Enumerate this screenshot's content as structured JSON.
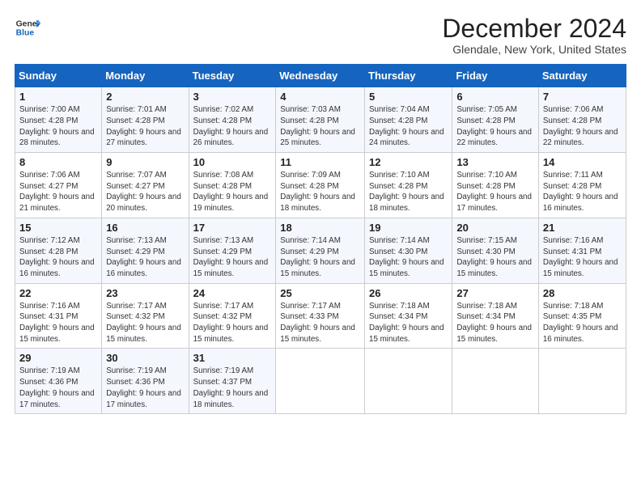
{
  "header": {
    "logo_line1": "General",
    "logo_line2": "Blue",
    "title": "December 2024",
    "subtitle": "Glendale, New York, United States"
  },
  "columns": [
    "Sunday",
    "Monday",
    "Tuesday",
    "Wednesday",
    "Thursday",
    "Friday",
    "Saturday"
  ],
  "weeks": [
    [
      {
        "day": "1",
        "rise": "Sunrise: 7:00 AM",
        "set": "Sunset: 4:28 PM",
        "day_text": "Daylight: 9 hours and 28 minutes."
      },
      {
        "day": "2",
        "rise": "Sunrise: 7:01 AM",
        "set": "Sunset: 4:28 PM",
        "day_text": "Daylight: 9 hours and 27 minutes."
      },
      {
        "day": "3",
        "rise": "Sunrise: 7:02 AM",
        "set": "Sunset: 4:28 PM",
        "day_text": "Daylight: 9 hours and 26 minutes."
      },
      {
        "day": "4",
        "rise": "Sunrise: 7:03 AM",
        "set": "Sunset: 4:28 PM",
        "day_text": "Daylight: 9 hours and 25 minutes."
      },
      {
        "day": "5",
        "rise": "Sunrise: 7:04 AM",
        "set": "Sunset: 4:28 PM",
        "day_text": "Daylight: 9 hours and 24 minutes."
      },
      {
        "day": "6",
        "rise": "Sunrise: 7:05 AM",
        "set": "Sunset: 4:28 PM",
        "day_text": "Daylight: 9 hours and 22 minutes."
      },
      {
        "day": "7",
        "rise": "Sunrise: 7:06 AM",
        "set": "Sunset: 4:28 PM",
        "day_text": "Daylight: 9 hours and 22 minutes."
      }
    ],
    [
      {
        "day": "8",
        "rise": "Sunrise: 7:06 AM",
        "set": "Sunset: 4:27 PM",
        "day_text": "Daylight: 9 hours and 21 minutes."
      },
      {
        "day": "9",
        "rise": "Sunrise: 7:07 AM",
        "set": "Sunset: 4:27 PM",
        "day_text": "Daylight: 9 hours and 20 minutes."
      },
      {
        "day": "10",
        "rise": "Sunrise: 7:08 AM",
        "set": "Sunset: 4:28 PM",
        "day_text": "Daylight: 9 hours and 19 minutes."
      },
      {
        "day": "11",
        "rise": "Sunrise: 7:09 AM",
        "set": "Sunset: 4:28 PM",
        "day_text": "Daylight: 9 hours and 18 minutes."
      },
      {
        "day": "12",
        "rise": "Sunrise: 7:10 AM",
        "set": "Sunset: 4:28 PM",
        "day_text": "Daylight: 9 hours and 18 minutes."
      },
      {
        "day": "13",
        "rise": "Sunrise: 7:10 AM",
        "set": "Sunset: 4:28 PM",
        "day_text": "Daylight: 9 hours and 17 minutes."
      },
      {
        "day": "14",
        "rise": "Sunrise: 7:11 AM",
        "set": "Sunset: 4:28 PM",
        "day_text": "Daylight: 9 hours and 16 minutes."
      }
    ],
    [
      {
        "day": "15",
        "rise": "Sunrise: 7:12 AM",
        "set": "Sunset: 4:28 PM",
        "day_text": "Daylight: 9 hours and 16 minutes."
      },
      {
        "day": "16",
        "rise": "Sunrise: 7:13 AM",
        "set": "Sunset: 4:29 PM",
        "day_text": "Daylight: 9 hours and 16 minutes."
      },
      {
        "day": "17",
        "rise": "Sunrise: 7:13 AM",
        "set": "Sunset: 4:29 PM",
        "day_text": "Daylight: 9 hours and 15 minutes."
      },
      {
        "day": "18",
        "rise": "Sunrise: 7:14 AM",
        "set": "Sunset: 4:29 PM",
        "day_text": "Daylight: 9 hours and 15 minutes."
      },
      {
        "day": "19",
        "rise": "Sunrise: 7:14 AM",
        "set": "Sunset: 4:30 PM",
        "day_text": "Daylight: 9 hours and 15 minutes."
      },
      {
        "day": "20",
        "rise": "Sunrise: 7:15 AM",
        "set": "Sunset: 4:30 PM",
        "day_text": "Daylight: 9 hours and 15 minutes."
      },
      {
        "day": "21",
        "rise": "Sunrise: 7:16 AM",
        "set": "Sunset: 4:31 PM",
        "day_text": "Daylight: 9 hours and 15 minutes."
      }
    ],
    [
      {
        "day": "22",
        "rise": "Sunrise: 7:16 AM",
        "set": "Sunset: 4:31 PM",
        "day_text": "Daylight: 9 hours and 15 minutes."
      },
      {
        "day": "23",
        "rise": "Sunrise: 7:17 AM",
        "set": "Sunset: 4:32 PM",
        "day_text": "Daylight: 9 hours and 15 minutes."
      },
      {
        "day": "24",
        "rise": "Sunrise: 7:17 AM",
        "set": "Sunset: 4:32 PM",
        "day_text": "Daylight: 9 hours and 15 minutes."
      },
      {
        "day": "25",
        "rise": "Sunrise: 7:17 AM",
        "set": "Sunset: 4:33 PM",
        "day_text": "Daylight: 9 hours and 15 minutes."
      },
      {
        "day": "26",
        "rise": "Sunrise: 7:18 AM",
        "set": "Sunset: 4:34 PM",
        "day_text": "Daylight: 9 hours and 15 minutes."
      },
      {
        "day": "27",
        "rise": "Sunrise: 7:18 AM",
        "set": "Sunset: 4:34 PM",
        "day_text": "Daylight: 9 hours and 15 minutes."
      },
      {
        "day": "28",
        "rise": "Sunrise: 7:18 AM",
        "set": "Sunset: 4:35 PM",
        "day_text": "Daylight: 9 hours and 16 minutes."
      }
    ],
    [
      {
        "day": "29",
        "rise": "Sunrise: 7:19 AM",
        "set": "Sunset: 4:36 PM",
        "day_text": "Daylight: 9 hours and 17 minutes."
      },
      {
        "day": "30",
        "rise": "Sunrise: 7:19 AM",
        "set": "Sunset: 4:36 PM",
        "day_text": "Daylight: 9 hours and 17 minutes."
      },
      {
        "day": "31",
        "rise": "Sunrise: 7:19 AM",
        "set": "Sunset: 4:37 PM",
        "day_text": "Daylight: 9 hours and 18 minutes."
      },
      null,
      null,
      null,
      null
    ]
  ]
}
